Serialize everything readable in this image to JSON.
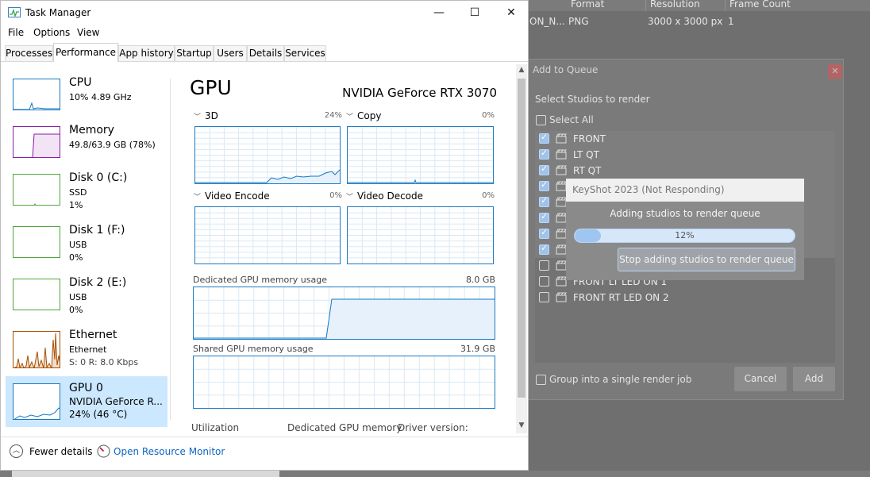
{
  "background_table": {
    "headers": [
      "Format",
      "Resolution",
      "Frame Count"
    ],
    "row": {
      "name": "ON_N...",
      "format": "PNG",
      "resolution": "3000 x 3000 px",
      "frames": "1"
    }
  },
  "add_to_queue": {
    "title": "Add to Queue",
    "close": "✕",
    "subtitle": "Select Studios to render",
    "select_all": "Select All",
    "items": [
      {
        "label": "FRONT",
        "checked": true
      },
      {
        "label": "LT QT",
        "checked": true
      },
      {
        "label": "RT QT",
        "checked": true
      },
      {
        "label": "",
        "checked": true
      },
      {
        "label": "",
        "checked": true
      },
      {
        "label": "",
        "checked": true
      },
      {
        "label": "",
        "checked": true
      },
      {
        "label": "",
        "checked": true
      },
      {
        "label": "",
        "checked": false
      },
      {
        "label": "FRONT LT LED ON 1",
        "checked": false
      },
      {
        "label": "FRONT RT LED ON 2",
        "checked": false
      }
    ],
    "group_label": "Group into a single render job",
    "cancel": "Cancel",
    "add": "Add"
  },
  "not_responding": {
    "title": "KeyShot 2023 (Not Responding)",
    "message": "Adding studios to render queue",
    "progress": 12,
    "progress_label": "12%",
    "stop_button": "Stop adding studios to render queue",
    "progress_color": "#9fc6f1"
  },
  "task_manager": {
    "title": "Task Manager",
    "window_controls": {
      "minimize": "—",
      "maximize": "☐",
      "close": "✕"
    },
    "menu": [
      "File",
      "Options",
      "View"
    ],
    "tabs": [
      "Processes",
      "Performance",
      "App history",
      "Startup",
      "Users",
      "Details",
      "Services"
    ],
    "active_tab": "Performance",
    "sidebar": [
      {
        "name": "CPU",
        "line2": "10% 4.89 GHz",
        "line3": "",
        "color": "#1379c2"
      },
      {
        "name": "Memory",
        "line2": "49.8/63.9 GB (78%)",
        "line3": "",
        "color": "#8b1aa8"
      },
      {
        "name": "Disk 0 (C:)",
        "line2": "SSD",
        "line3": "1%",
        "color": "#4da53a"
      },
      {
        "name": "Disk 1 (F:)",
        "line2": "USB",
        "line3": "0%",
        "color": "#4da53a"
      },
      {
        "name": "Disk 2 (E:)",
        "line2": "USB",
        "line3": "0%",
        "color": "#4da53a"
      },
      {
        "name": "Ethernet",
        "line2": "Ethernet",
        "line3": "S: 0  R: 8.0 Kbps",
        "color": "#a74f01"
      },
      {
        "name": "GPU 0",
        "line2": "NVIDIA GeForce R...",
        "line3": "24%  (46 °C)",
        "color": "#1379c2"
      }
    ],
    "gpu": {
      "heading": "GPU",
      "model": "NVIDIA GeForce RTX 3070",
      "engines": [
        {
          "name": "3D",
          "pct": "24%"
        },
        {
          "name": "Copy",
          "pct": "0%"
        },
        {
          "name": "Video Encode",
          "pct": "0%"
        },
        {
          "name": "Video Decode",
          "pct": "0%"
        }
      ],
      "dedicated_label": "Dedicated GPU memory usage",
      "dedicated_value": "8.0 GB",
      "shared_label": "Shared GPU memory usage",
      "shared_value": "31.9 GB",
      "stats": [
        "Utilization",
        "Dedicated GPU memory",
        "Driver version:"
      ]
    },
    "footer": {
      "fewer": "Fewer details",
      "resource_monitor": "Open Resource Monitor"
    }
  }
}
